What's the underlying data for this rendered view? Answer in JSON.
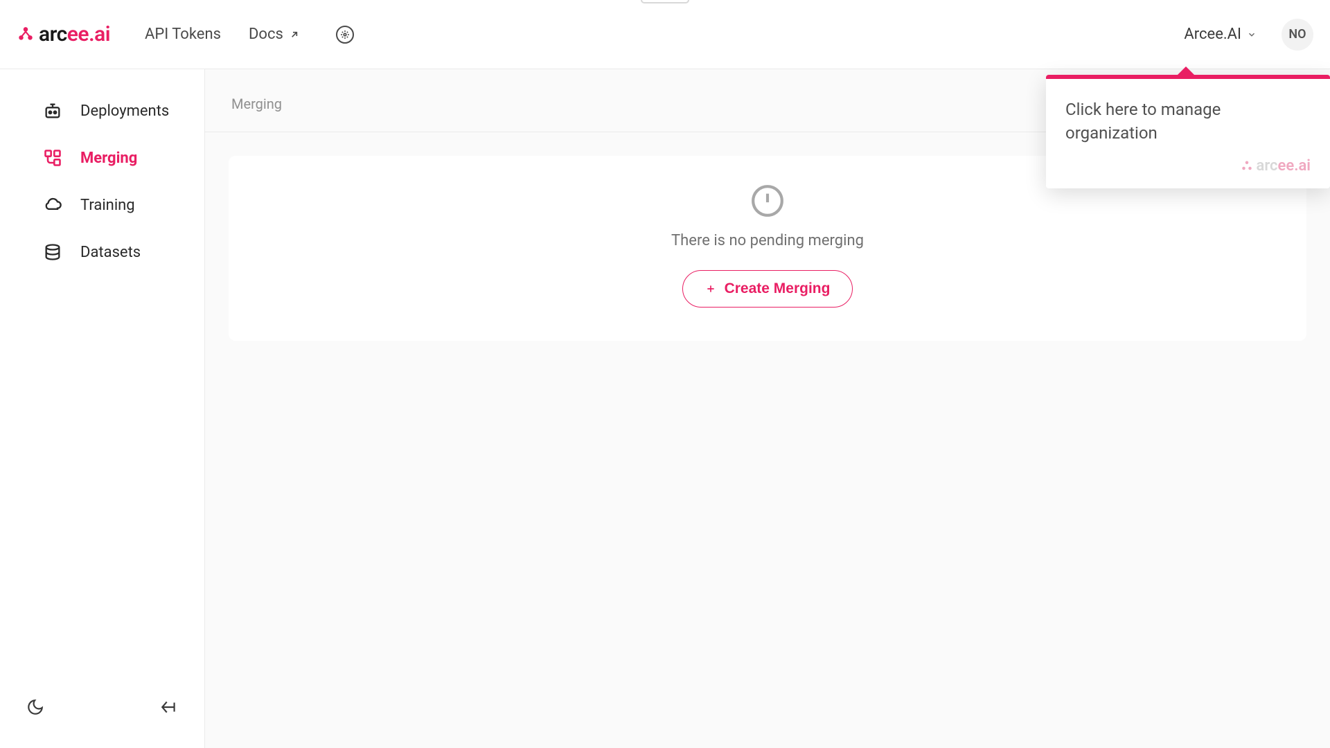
{
  "colors": {
    "accent": "#e91e63",
    "text_primary": "#2a2a2a",
    "text_muted": "#909090"
  },
  "header": {
    "logo_text_prefix": "arc",
    "logo_text_suffix": "ee.ai",
    "nav": {
      "api_tokens": "API Tokens",
      "docs": "Docs"
    },
    "org_name": "Arcee.AI",
    "avatar_initials": "NO"
  },
  "sidebar": {
    "items": [
      {
        "label": "Deployments",
        "icon": "robot-icon",
        "active": false
      },
      {
        "label": "Merging",
        "icon": "merge-icon",
        "active": true
      },
      {
        "label": "Training",
        "icon": "cloud-icon",
        "active": false
      },
      {
        "label": "Datasets",
        "icon": "database-icon",
        "active": false
      }
    ]
  },
  "main": {
    "breadcrumb": "Merging",
    "empty_message": "There is no pending merging",
    "create_button": "Create Merging"
  },
  "tooltip": {
    "message": "Click here to manage organization",
    "brand_prefix": "arc",
    "brand_suffix": "ee.ai"
  }
}
